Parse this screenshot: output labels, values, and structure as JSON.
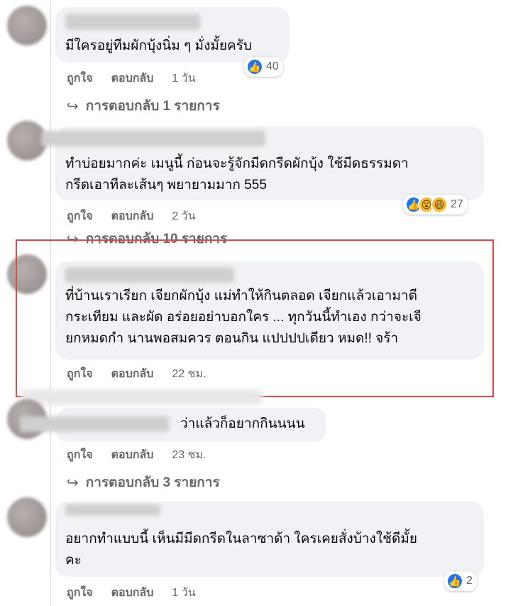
{
  "comments": [
    {
      "text": "มีใครอยู่ทีมผักบุ้งนิ่ม ๆ มั่งมั้ยครับ",
      "like_label": "ถูกใจ",
      "reply_label": "ตอบกลับ",
      "time": "1 วัน",
      "reaction_count": "40",
      "replies_label": "การตอบกลับ 1 รายการ"
    },
    {
      "text": "ทำบ่อยมากค่ะ เมนูนี้ ก่อนจะรู้จักมีดกรีดผักบุ้ง ใช้มีดธรรมดา\nกรีดเอาทีละเส้นๆ พยายามมาก 555",
      "like_label": "ถูกใจ",
      "reply_label": "ตอบกลับ",
      "time": "2 วัน",
      "reaction_count": "27",
      "replies_label": "การตอบกลับ 10 รายการ"
    },
    {
      "text": "ที่บ้านเราเรียก เจียกผักบุ้ง แม่ทำให้กินตลอด เจียกแล้วเอามาตี\nกระเทียม และผัด อร่อยอย่าบอกใคร ... ทุกวันนี้ทำเอง กว่าจะเจี\nยกหมดกำ นานพอสมควร ตอนกิน แปปปปเดียว หมด!! จร้า",
      "like_label": "ถูกใจ",
      "reply_label": "ตอบกลับ",
      "time": "22 ชม."
    },
    {
      "text_suffix": "ว่าแล้วก็อยากกินนนน",
      "like_label": "ถูกใจ",
      "reply_label": "ตอบกลับ",
      "time": "23 ชม.",
      "replies_label": "การตอบกลับ 3 รายการ"
    },
    {
      "text": "อยากทำแบบนี้ เห็นมีมีดกรีดในลาซาด้า ใครเคยสั่งบ้างใช้ดีมั้ย\nคะ",
      "like_label": "ถูกใจ",
      "reply_label": "ตอบกลับ",
      "time": "1 วัน",
      "reaction_count": "2"
    }
  ],
  "icons": {
    "like": "like-icon",
    "wow": "wow-icon",
    "haha": "haha-icon",
    "reply_arrow": "reply-arrow-icon"
  },
  "colors": {
    "bubble": "#f0f2f5",
    "secondary_text": "#65676b",
    "like_blue": "#1877f2",
    "highlight_red": "#e04848"
  }
}
